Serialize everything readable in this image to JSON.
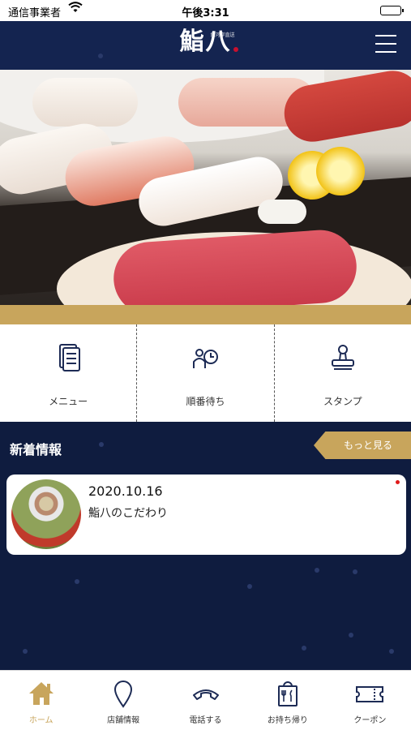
{
  "status_bar": {
    "carrier": "通信事業者",
    "time": "午後3:31"
  },
  "header": {
    "logo_text": "鮨八",
    "logo_subtext": "魚河岸直送",
    "menu_icon": "hamburger-icon"
  },
  "quick_menu": {
    "items": [
      {
        "label": "メニュー",
        "icon": "document-icon"
      },
      {
        "label": "順番待ち",
        "icon": "queue-clock-icon"
      },
      {
        "label": "スタンプ",
        "icon": "stamp-icon"
      }
    ]
  },
  "news": {
    "section_title": "新着情報",
    "more_label": "もっと見る",
    "items": [
      {
        "date": "2020.10.16",
        "title": "鮨八のこだわり"
      }
    ]
  },
  "tabbar": {
    "items": [
      {
        "label": "ホーム",
        "icon": "home-icon",
        "active": true
      },
      {
        "label": "店舗情報",
        "icon": "map-pin-icon",
        "active": false
      },
      {
        "label": "電話する",
        "icon": "phone-icon",
        "active": false
      },
      {
        "label": "お持ち帰り",
        "icon": "takeout-bag-icon",
        "active": false
      },
      {
        "label": "クーポン",
        "icon": "coupon-icon",
        "active": false
      }
    ]
  },
  "colors": {
    "navy": "#142450",
    "background": "#0f1c3f",
    "gold": "#c8a55c",
    "unread_dot": "#e01a1a"
  }
}
